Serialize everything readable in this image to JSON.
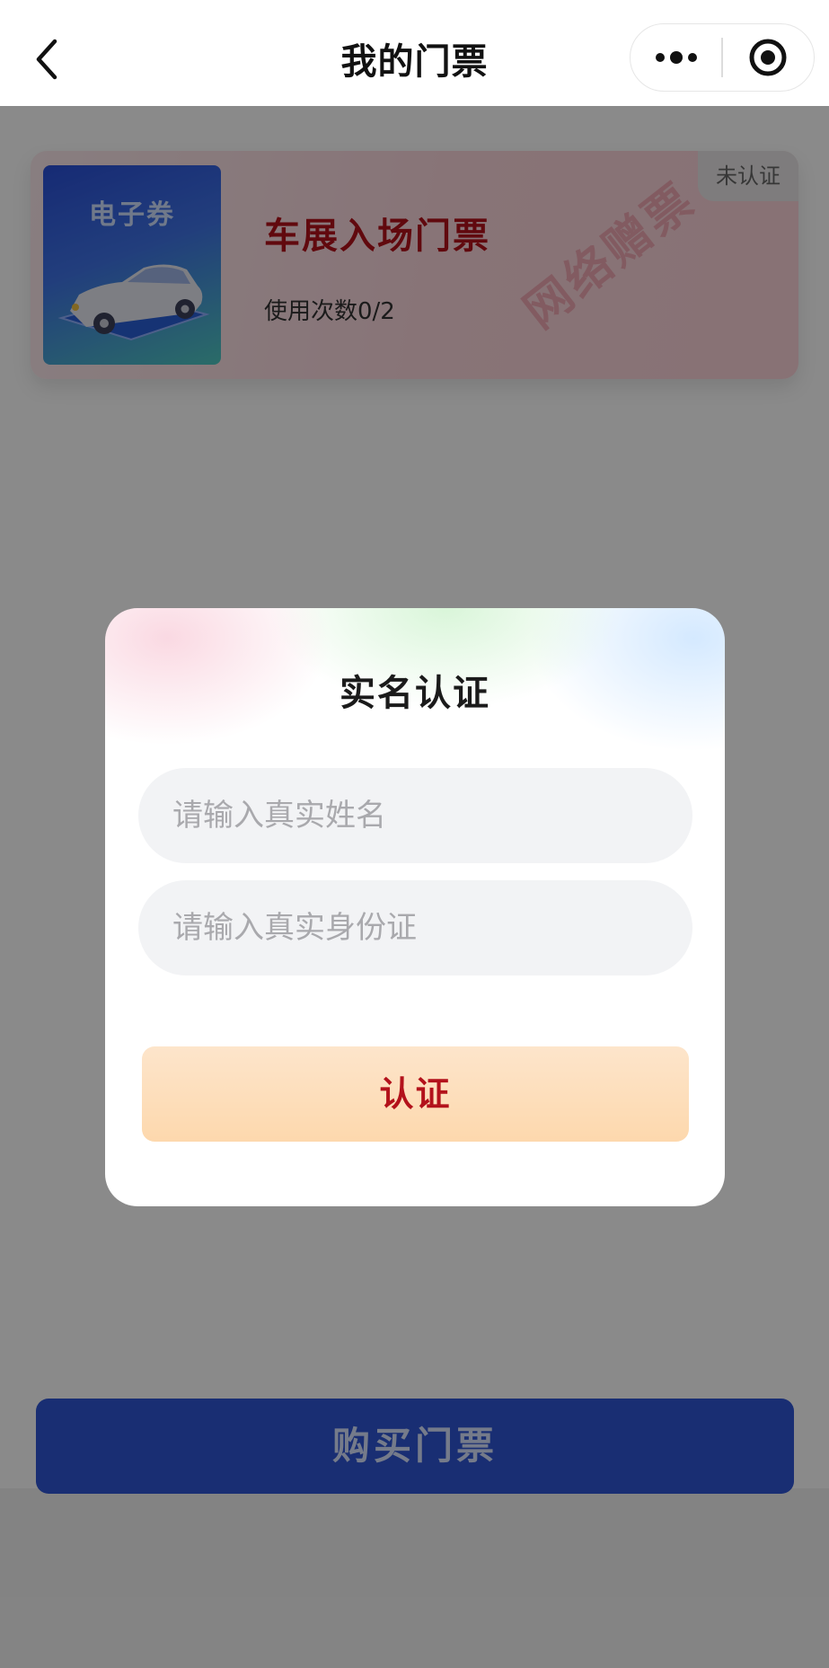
{
  "navbar": {
    "title": "我的门票",
    "back_icon": "chevron-left-icon",
    "more_icon": "more-dots-icon",
    "close_icon": "target-circle-icon"
  },
  "ticket": {
    "thumb_label": "电子券",
    "title": "车展入场门票",
    "usage": "使用次数0/2",
    "status_badge": "未认证",
    "watermark": "网络赠票",
    "accent_color": "#b3121b"
  },
  "bottom": {
    "buy_label": "购买门票",
    "buy_color": "#2f55d4"
  },
  "dialog": {
    "title": "实名认证",
    "name_field": {
      "value": "",
      "placeholder": "请输入真实姓名"
    },
    "id_field": {
      "value": "",
      "placeholder": "请输入真实身份证"
    },
    "confirm_label": "认证"
  }
}
